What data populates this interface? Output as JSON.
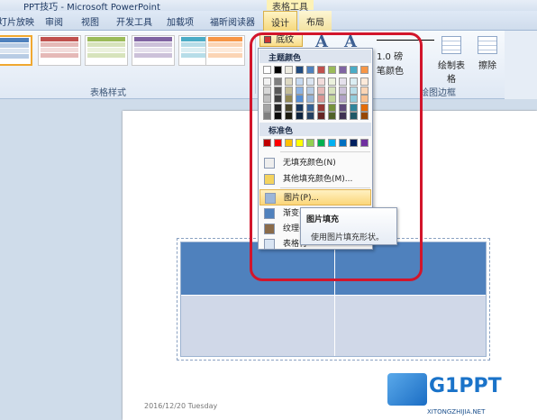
{
  "titlebar": {
    "title": "PPT技巧 - Microsoft PowerPoint",
    "context_title": "表格工具"
  },
  "tabs": [
    {
      "label": "灯片放映"
    },
    {
      "label": "审阅"
    },
    {
      "label": "视图"
    },
    {
      "label": "开发工具"
    },
    {
      "label": "加载项"
    },
    {
      "label": "福昕阅读器"
    },
    {
      "label": "设计",
      "active": true
    },
    {
      "label": "布局"
    }
  ],
  "ribbon": {
    "table_styles_label": "表格样式",
    "shading_label": "底纹",
    "pen_weight": "1.0 磅",
    "pen_color_label": "笔颜色",
    "draw_table_label": "绘制表格",
    "eraser_label": "擦除",
    "draw_borders_label": "绘图边框"
  },
  "shading_menu": {
    "theme_colors_title": "主题颜色",
    "theme_colors": [
      "#ffffff",
      "#000000",
      "#eeece1",
      "#1f497d",
      "#4f81bd",
      "#c0504d",
      "#9bbb59",
      "#8064a2",
      "#4bacc6",
      "#f79646"
    ],
    "theme_shades": [
      [
        "#f2f2f2",
        "#7f7f7f",
        "#ddd9c3",
        "#c6d9f0",
        "#dbe5f1",
        "#f2dcdb",
        "#ebf1dd",
        "#e5e0ec",
        "#dbeef3",
        "#fdeada"
      ],
      [
        "#d8d8d8",
        "#595959",
        "#c4bd97",
        "#8db3e2",
        "#b8cce4",
        "#e5b9b7",
        "#d7e3bc",
        "#ccc1d9",
        "#b7dde8",
        "#fbd5b5"
      ],
      [
        "#bfbfbf",
        "#3f3f3f",
        "#938953",
        "#548dd4",
        "#95b3d7",
        "#d99694",
        "#c3d69b",
        "#b2a2c7",
        "#92cddc",
        "#fac08f"
      ],
      [
        "#a5a5a5",
        "#262626",
        "#494429",
        "#17365d",
        "#366092",
        "#953734",
        "#76923c",
        "#5f497a",
        "#31859b",
        "#e36c09"
      ],
      [
        "#7f7f7f",
        "#0c0c0c",
        "#1d1b10",
        "#0f243e",
        "#244061",
        "#632423",
        "#4f6128",
        "#3f3151",
        "#205867",
        "#974806"
      ]
    ],
    "standard_colors_title": "标准色",
    "standard_colors": [
      "#c00000",
      "#ff0000",
      "#ffc000",
      "#ffff00",
      "#92d050",
      "#00b050",
      "#00b0f0",
      "#0070c0",
      "#002060",
      "#7030a0"
    ],
    "items": [
      {
        "label": "无填充颜色(N)",
        "icon": "no-fill-icon"
      },
      {
        "label": "其他填充颜色(M)...",
        "icon": "color-palette-icon"
      },
      {
        "label": "图片(P)...",
        "icon": "picture-icon",
        "highlighted": true
      },
      {
        "label": "渐变(G)",
        "icon": "gradient-icon"
      },
      {
        "label": "纹理(",
        "icon": "texture-icon"
      },
      {
        "label": "表格背",
        "icon": "table-background-icon"
      }
    ]
  },
  "tooltip": {
    "title": "图片填充",
    "description": "使用图片填充形状。"
  },
  "slide": {
    "date": "2016/12/20 Tuesday"
  },
  "watermark": {
    "site": "G1PPT",
    "url": "XITONGZHIJIA.NET"
  }
}
